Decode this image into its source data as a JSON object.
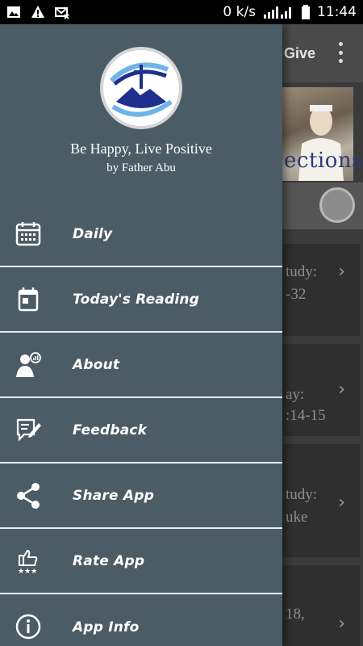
{
  "status_bar": {
    "network_speed": "0 k/s",
    "time": "11:44",
    "icons": [
      "image-icon",
      "warning-icon",
      "mail-off-icon",
      "signal-icon",
      "battery-icon"
    ]
  },
  "background_app": {
    "toolbar_title_partial": "Give",
    "banner_text_partial": "ections",
    "cards": [
      {
        "line1": "tudy:",
        "line2": "-32"
      },
      {
        "line1": "ay:",
        "line2": ":14-15"
      },
      {
        "line1": "tudy:",
        "line2": "uke"
      },
      {
        "line1": "18,",
        "line2": ""
      }
    ]
  },
  "drawer": {
    "app_name": "Be Happy, Live Positive",
    "author": "by Father Abu",
    "items": [
      {
        "label": "Daily",
        "icon": "calendar-icon"
      },
      {
        "label": "Today's Reading",
        "icon": "calendar-today-icon"
      },
      {
        "label": "About",
        "icon": "about-person-icon"
      },
      {
        "label": "Feedback",
        "icon": "feedback-icon"
      },
      {
        "label": "Share App",
        "icon": "share-icon"
      },
      {
        "label": "Rate App",
        "icon": "rate-thumbs-up-icon"
      },
      {
        "label": "App Info",
        "icon": "info-icon"
      }
    ]
  },
  "colors": {
    "drawer_bg": "#4b5c66",
    "divider": "#e7ecef",
    "logo_blue": "#1f2f8f"
  }
}
